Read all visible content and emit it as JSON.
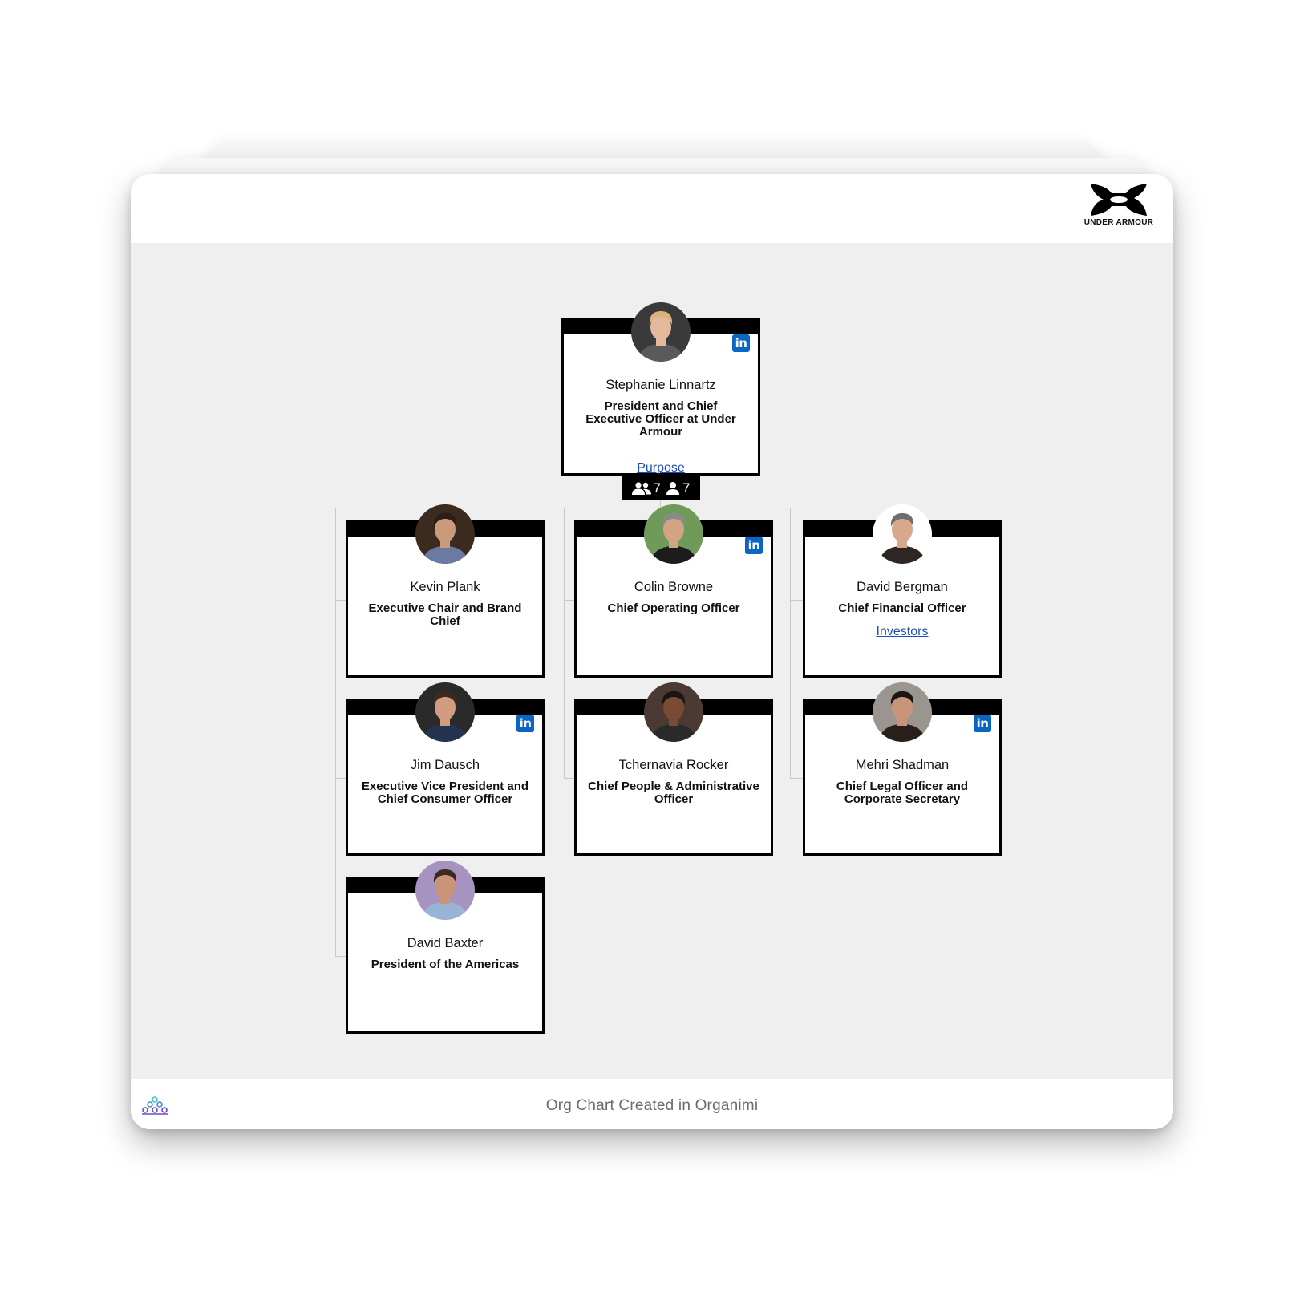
{
  "brand": {
    "name": "UNDER ARMOUR",
    "logo_icon": "under-armour-logo-icon"
  },
  "footer": {
    "text": "Org Chart Created in Organimi",
    "logo_icon": "organimi-logo-icon"
  },
  "root": {
    "name": "Stephanie Linnartz",
    "title": "President and Chief Executive Officer at Under Armour",
    "link": "Purpose",
    "linkedin": true,
    "counts": {
      "team_icon": "people-icon",
      "team": "7",
      "direct_icon": "person-icon",
      "direct": "7"
    }
  },
  "reports": [
    {
      "name": "Kevin Plank",
      "title": "Executive Chair and Brand Chief",
      "link": "",
      "linkedin": false,
      "photo_bg": "#3b2a1e",
      "shirt": "#6b7aa0",
      "skin": "#c99a7c",
      "hair": "#2a1f18"
    },
    {
      "name": "Colin Browne",
      "title": "Chief Operating Officer",
      "link": "",
      "linkedin": true,
      "photo_bg": "#6f9a5a",
      "shirt": "#1c1c1c",
      "skin": "#d3a484",
      "hair": "#8a8a8a"
    },
    {
      "name": "David Bergman",
      "title": "Chief Financial Officer",
      "link": "Investors",
      "linkedin": false,
      "photo_bg": "#ffffff",
      "shirt": "#2e2622",
      "skin": "#d9a88c",
      "hair": "#6e6e6e"
    },
    {
      "name": "Jim Dausch",
      "title": "Executive Vice President and Chief Consumer Officer",
      "link": "",
      "linkedin": true,
      "photo_bg": "#2a2a2a",
      "shirt": "#22324f",
      "skin": "#d19c80",
      "hair": "#3a2a20"
    },
    {
      "name": "Tchernavia Rocker",
      "title": "Chief People & Administrative Officer",
      "link": "",
      "linkedin": false,
      "photo_bg": "#4a3a33",
      "shirt": "#2a2a2a",
      "skin": "#7a4a32",
      "hair": "#1a1412"
    },
    {
      "name": "Mehri Shadman",
      "title": "Chief Legal Officer and Corporate Secretary",
      "link": "",
      "linkedin": true,
      "photo_bg": "#9b9590",
      "shirt": "#2a1e1a",
      "skin": "#c9957a",
      "hair": "#1a1412"
    },
    {
      "name": "David Baxter",
      "title": "President of the Americas",
      "link": "",
      "linkedin": false,
      "photo_bg": "#a793c0",
      "shirt": "#9ab4d8",
      "skin": "#c99478",
      "hair": "#3a2a20"
    }
  ],
  "root_photo": {
    "photo_bg": "#3a3a3a",
    "shirt": "#5a5a5a",
    "skin": "#e2b99c",
    "hair": "#d8b47a"
  },
  "linkedin_label": "in"
}
